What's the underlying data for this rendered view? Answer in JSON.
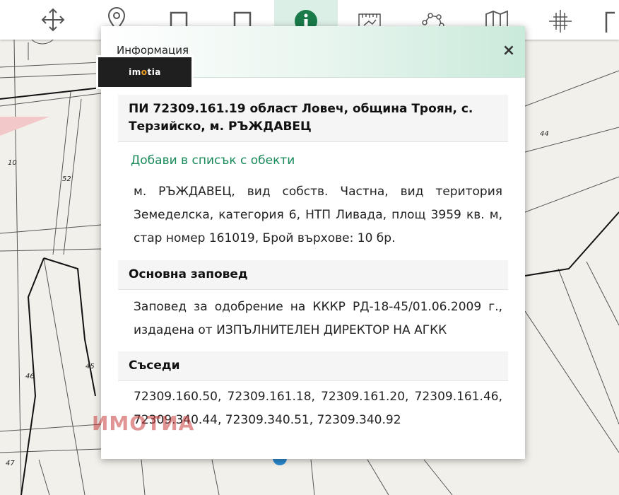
{
  "map": {
    "parcel_labels": [
      "10",
      "52",
      "44",
      "46",
      "45",
      "47"
    ]
  },
  "toolbar": {
    "tools": [
      {
        "name": "pan",
        "icon": "move-icon"
      },
      {
        "name": "location",
        "icon": "map-pin-icon"
      },
      {
        "name": "flag",
        "icon": "flag-icon"
      },
      {
        "name": "flag-square",
        "icon": "flag-square-icon"
      },
      {
        "name": "info",
        "icon": "info-icon",
        "active": true
      },
      {
        "name": "measure-area",
        "icon": "ruler-area-icon"
      },
      {
        "name": "polygon",
        "icon": "polygon-icon"
      },
      {
        "name": "map",
        "icon": "map-icon"
      },
      {
        "name": "crosshair",
        "icon": "crosshair-icon"
      }
    ],
    "active_color": "#dcefe6"
  },
  "panel": {
    "title": "Информация",
    "close": "×",
    "logo_text": {
      "pre": "im",
      "o": "o",
      "post": "tia"
    },
    "parcel_heading": "ПИ 72309.161.19 област Ловеч, община Троян, с. Терзийско, м. РЪЖДАВЕЦ",
    "add_to_list": "Добави в списък с обекти",
    "description": "м. РЪЖДАВЕЦ, вид собств. Частна, вид територия Земеделска, категория 6, НТП Ливада, площ 3959 кв. м, стар номер 161019, Брой върхове: 10 бр.",
    "order_heading": "Основна заповед",
    "order_text": "Заповед за одобрение на КККР РД-18-45/01.06.2009 г., издадена от ИЗПЪЛНИТЕЛЕН ДИРЕКТОР НА АГКК",
    "neighbors_heading": "Съседи",
    "neighbors_text": "72309.160.50, 72309.161.18, 72309.161.20, 72309.161.46, 72309.340.44, 72309.340.51, 72309.340.92",
    "link_color": "#1a8a5a"
  },
  "watermark": "ИМОТИА"
}
